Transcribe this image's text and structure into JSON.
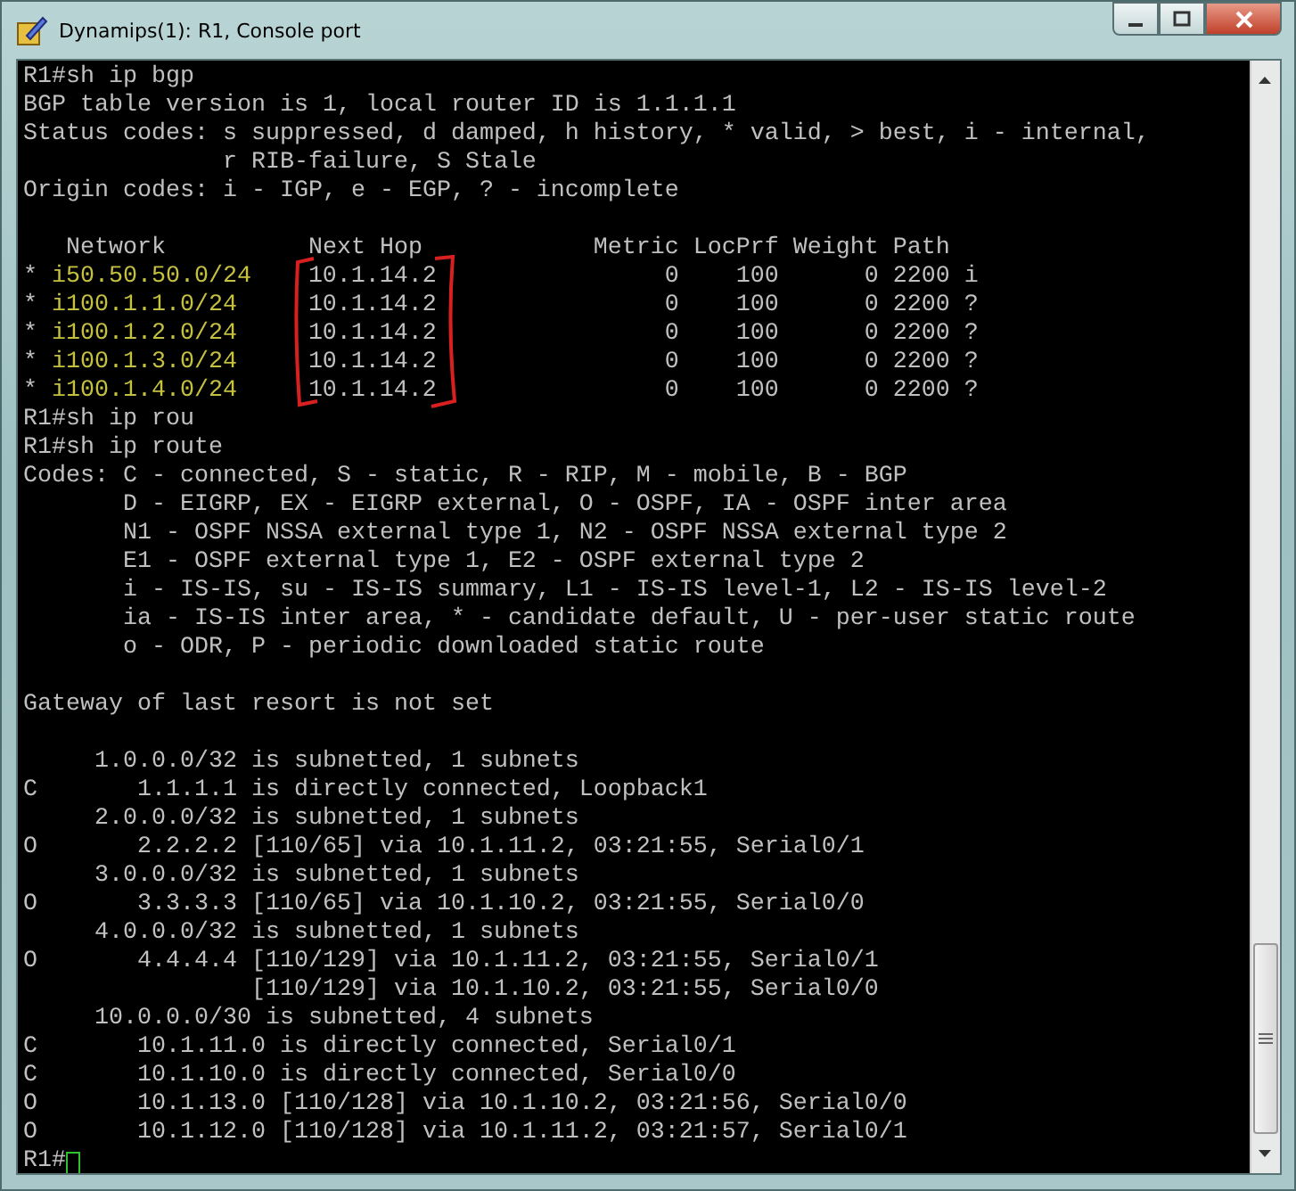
{
  "window": {
    "title": "Dynamips(1): R1, Console port"
  },
  "console": {
    "lines": [
      {
        "kind": "text",
        "text": "R1#sh ip bgp"
      },
      {
        "kind": "text",
        "text": "BGP table version is 1, local router ID is 1.1.1.1"
      },
      {
        "kind": "text",
        "text": "Status codes: s suppressed, d damped, h history, * valid, > best, i - internal,"
      },
      {
        "kind": "text",
        "text": "              r RIB-failure, S Stale"
      },
      {
        "kind": "text",
        "text": "Origin codes: i - IGP, e - EGP, ? - incomplete"
      },
      {
        "kind": "blank"
      },
      {
        "kind": "text",
        "text": "   Network          Next Hop            Metric LocPrf Weight Path"
      },
      {
        "kind": "bgp_row",
        "flag": "*",
        "network": "i50.50.50.0/24",
        "next_hop": "10.1.14.2",
        "metric": "0",
        "locprf": "100",
        "weight": "0",
        "path": "2200 i"
      },
      {
        "kind": "bgp_row",
        "flag": "*",
        "network": "i100.1.1.0/24",
        "next_hop": "10.1.14.2",
        "metric": "0",
        "locprf": "100",
        "weight": "0",
        "path": "2200 ?"
      },
      {
        "kind": "bgp_row",
        "flag": "*",
        "network": "i100.1.2.0/24",
        "next_hop": "10.1.14.2",
        "metric": "0",
        "locprf": "100",
        "weight": "0",
        "path": "2200 ?"
      },
      {
        "kind": "bgp_row",
        "flag": "*",
        "network": "i100.1.3.0/24",
        "next_hop": "10.1.14.2",
        "metric": "0",
        "locprf": "100",
        "weight": "0",
        "path": "2200 ?"
      },
      {
        "kind": "bgp_row",
        "flag": "*",
        "network": "i100.1.4.0/24",
        "next_hop": "10.1.14.2",
        "metric": "0",
        "locprf": "100",
        "weight": "0",
        "path": "2200 ?"
      },
      {
        "kind": "text",
        "text": "R1#sh ip rou"
      },
      {
        "kind": "text",
        "text": "R1#sh ip route"
      },
      {
        "kind": "text",
        "text": "Codes: C - connected, S - static, R - RIP, M - mobile, B - BGP"
      },
      {
        "kind": "text",
        "text": "       D - EIGRP, EX - EIGRP external, O - OSPF, IA - OSPF inter area"
      },
      {
        "kind": "text",
        "text": "       N1 - OSPF NSSA external type 1, N2 - OSPF NSSA external type 2"
      },
      {
        "kind": "text",
        "text": "       E1 - OSPF external type 1, E2 - OSPF external type 2"
      },
      {
        "kind": "text",
        "text": "       i - IS-IS, su - IS-IS summary, L1 - IS-IS level-1, L2 - IS-IS level-2"
      },
      {
        "kind": "text",
        "text": "       ia - IS-IS inter area, * - candidate default, U - per-user static route"
      },
      {
        "kind": "text",
        "text": "       o - ODR, P - periodic downloaded static route"
      },
      {
        "kind": "blank"
      },
      {
        "kind": "text",
        "text": "Gateway of last resort is not set"
      },
      {
        "kind": "blank"
      },
      {
        "kind": "text",
        "text": "     1.0.0.0/32 is subnetted, 1 subnets"
      },
      {
        "kind": "text",
        "text": "C       1.1.1.1 is directly connected, Loopback1"
      },
      {
        "kind": "text",
        "text": "     2.0.0.0/32 is subnetted, 1 subnets"
      },
      {
        "kind": "text",
        "text": "O       2.2.2.2 [110/65] via 10.1.11.2, 03:21:55, Serial0/1"
      },
      {
        "kind": "text",
        "text": "     3.0.0.0/32 is subnetted, 1 subnets"
      },
      {
        "kind": "text",
        "text": "O       3.3.3.3 [110/65] via 10.1.10.2, 03:21:55, Serial0/0"
      },
      {
        "kind": "text",
        "text": "     4.0.0.0/32 is subnetted, 1 subnets"
      },
      {
        "kind": "text",
        "text": "O       4.4.4.4 [110/129] via 10.1.11.2, 03:21:55, Serial0/1"
      },
      {
        "kind": "text",
        "text": "                [110/129] via 10.1.10.2, 03:21:55, Serial0/0"
      },
      {
        "kind": "text",
        "text": "     10.0.0.0/30 is subnetted, 4 subnets"
      },
      {
        "kind": "text",
        "text": "C       10.1.11.0 is directly connected, Serial0/1"
      },
      {
        "kind": "text",
        "text": "C       10.1.10.0 is directly connected, Serial0/0"
      },
      {
        "kind": "text",
        "text": "O       10.1.13.0 [110/128] via 10.1.10.2, 03:21:56, Serial0/0"
      },
      {
        "kind": "text",
        "text": "O       10.1.12.0 [110/128] via 10.1.11.2, 03:21:57, Serial0/1"
      },
      {
        "kind": "prompt",
        "text": "R1#"
      }
    ]
  }
}
